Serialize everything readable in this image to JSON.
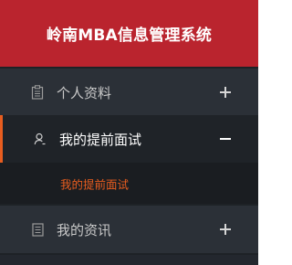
{
  "app": {
    "title": "岭南MBA信息管理系统"
  },
  "colors": {
    "header_bg": "#ba242e",
    "sidebar_bg": "#23272e",
    "accent": "#e85d1f",
    "active_item_bg": "#1f2328",
    "submenu_bg": "#1a1d21"
  },
  "sidebar": {
    "items": [
      {
        "label": "个人资料",
        "icon": "clipboard-icon",
        "toggle": "plus-icon",
        "expanded": false
      },
      {
        "label": "我的提前面试",
        "icon": "user-icon",
        "toggle": "minus-icon",
        "expanded": true,
        "subitems": [
          {
            "label": "我的提前面试",
            "active": true
          }
        ]
      },
      {
        "label": "我的资讯",
        "icon": "document-icon",
        "toggle": "plus-icon",
        "expanded": false
      }
    ]
  }
}
